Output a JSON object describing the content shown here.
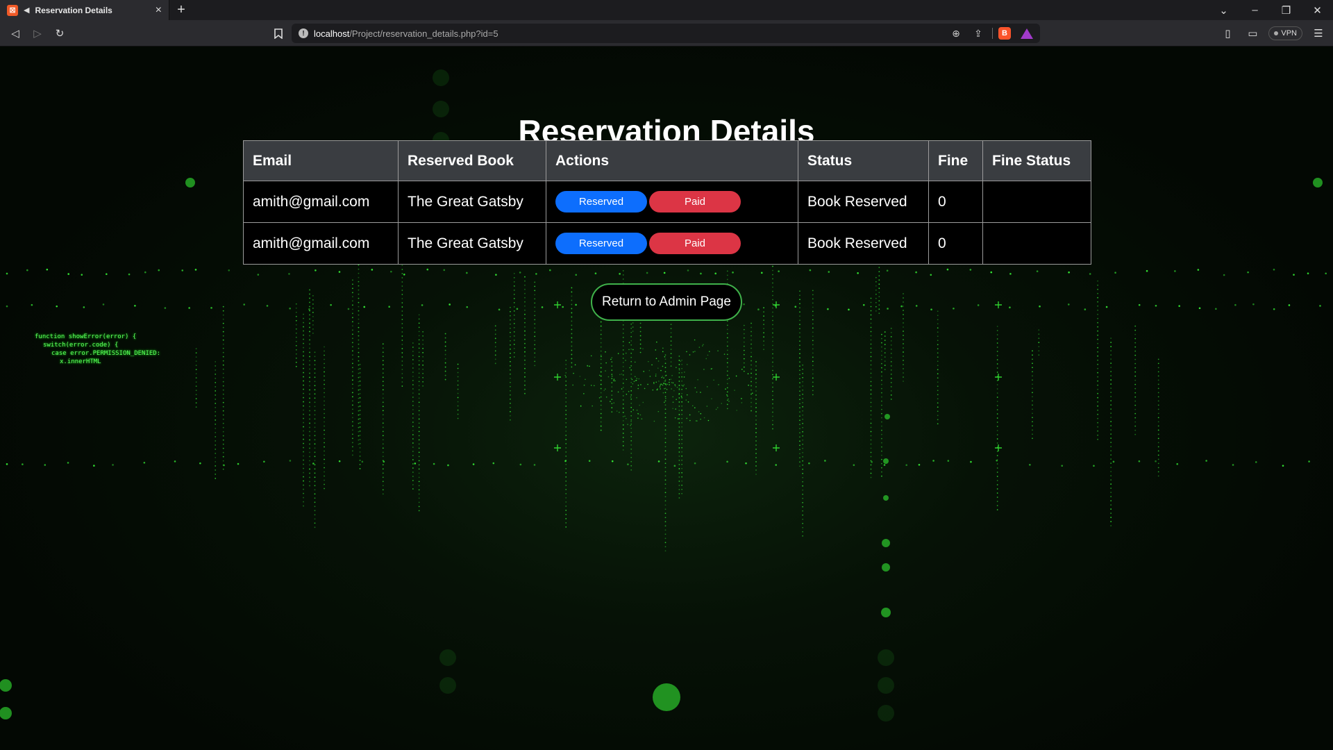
{
  "browser": {
    "tab_title": "Reservation Details",
    "new_tab_label": "+",
    "url_host": "localhost",
    "url_path": "/Project/reservation_details.php?id=5",
    "vpn_label": "VPN"
  },
  "page": {
    "title": "Reservation Details",
    "return_button": "Return to Admin Page"
  },
  "table": {
    "headers": [
      "Email",
      "Reserved Book",
      "Actions",
      "Status",
      "Fine",
      "Fine Status"
    ],
    "rows": [
      {
        "email": "amith@gmail.com",
        "book": "The Great Gatsby",
        "action_reserved": "Reserved",
        "action_paid": "Paid",
        "status": "Book Reserved",
        "fine": "0",
        "fine_status": ""
      },
      {
        "email": "amith@gmail.com",
        "book": "The Great Gatsby",
        "action_reserved": "Reserved",
        "action_paid": "Paid",
        "status": "Book Reserved",
        "fine": "0",
        "fine_status": ""
      }
    ]
  },
  "background": {
    "code_lines": [
      "function showError(error) {",
      "  switch(error.code) {",
      "    case error.PERMISSION_DENIED:",
      "      x.innerHTML"
    ]
  },
  "colors": {
    "reserved_button": "#0d6efd",
    "paid_button": "#dc3545",
    "return_border": "#3fb14a",
    "header_bg": "#3a3d41",
    "matrix_green": "#39ff39"
  },
  "icons": [
    "back-icon",
    "forward-icon",
    "reload-icon",
    "bookmark-icon",
    "site-info-icon",
    "zoom-icon",
    "share-icon",
    "brave-shields-icon",
    "brave-rewards-icon",
    "sidebar-icon",
    "wallet-icon",
    "menu-icon"
  ]
}
